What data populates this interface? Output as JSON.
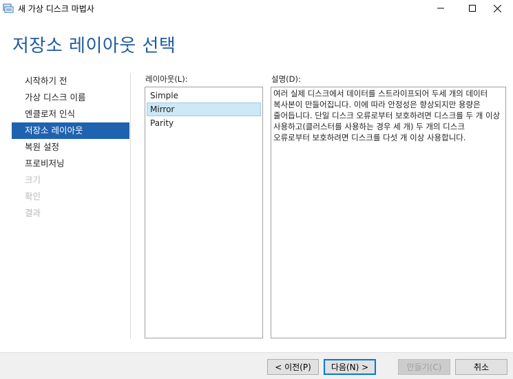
{
  "window": {
    "title": "새 가상 디스크 마법사",
    "minimize_glyph": "—",
    "maximize_glyph": "☐",
    "close_glyph": "✕"
  },
  "page": {
    "heading": "저장소 레이아웃 선택"
  },
  "nav": {
    "items": [
      {
        "label": "시작하기 전",
        "state": "normal"
      },
      {
        "label": "가상 디스크 이름",
        "state": "normal"
      },
      {
        "label": "엔클로저 인식",
        "state": "normal"
      },
      {
        "label": "저장소 레이아웃",
        "state": "active"
      },
      {
        "label": "복원 설정",
        "state": "normal"
      },
      {
        "label": "프로비저닝",
        "state": "normal"
      },
      {
        "label": "크기",
        "state": "disabled"
      },
      {
        "label": "확인",
        "state": "disabled"
      },
      {
        "label": "결과",
        "state": "disabled"
      }
    ]
  },
  "layout": {
    "label": "레이아웃(L):",
    "options": [
      "Simple",
      "Mirror",
      "Parity"
    ],
    "selected": "Mirror"
  },
  "description": {
    "label": "설명(D):",
    "text": "여러 실제 디스크에서 데이터를 스트라이프되어 두세 개의 데이터 복사본이 만들어집니다. 이에 따라 안정성은 향상되지만 용량은 줄어듭니다. 단일 디스크 오류로부터 보호하려면 디스크를 두 개 이상 사용하고(클러스터를 사용하는 경우 세 개) 두 개의 디스크 오류로부터 보호하려면 디스크를 다섯 개 이상 사용합니다."
  },
  "buttons": {
    "prev": "< 이전(P)",
    "next": "다음(N) >",
    "create": "만들기(C)",
    "cancel": "취소"
  },
  "colors": {
    "heading": "#1e5aa0",
    "nav_active_bg": "#1f62b0",
    "list_selected_bg": "#cce8f6"
  }
}
